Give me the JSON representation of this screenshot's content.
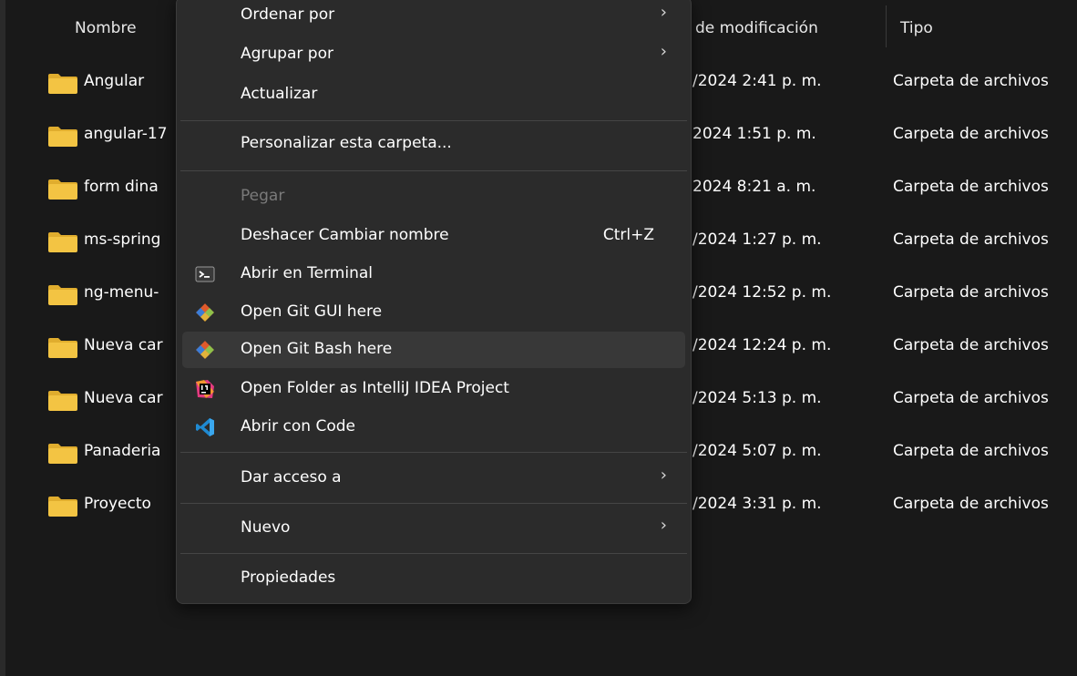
{
  "columns": {
    "name": "Nombre",
    "date": "de modificación",
    "type": "Tipo"
  },
  "rows": [
    {
      "name": "Angular",
      "date": "/2024 2:41 p. m.",
      "type": "Carpeta de archivos"
    },
    {
      "name": "angular-17",
      "date": "2024 1:51 p. m.",
      "type": "Carpeta de archivos"
    },
    {
      "name": "form dina",
      "date": "2024 8:21 a. m.",
      "type": "Carpeta de archivos"
    },
    {
      "name": "ms-spring",
      "date": "/2024 1:27 p. m.",
      "type": "Carpeta de archivos"
    },
    {
      "name": "ng-menu-",
      "date": "/2024 12:52 p. m.",
      "type": "Carpeta de archivos"
    },
    {
      "name": "Nueva car",
      "date": "/2024 12:24 p. m.",
      "type": "Carpeta de archivos"
    },
    {
      "name": "Nueva car",
      "date": "/2024 5:13 p. m.",
      "type": "Carpeta de archivos"
    },
    {
      "name": "Panaderia",
      "date": "/2024 5:07 p. m.",
      "type": "Carpeta de archivos"
    },
    {
      "name": "Proyecto",
      "date": "/2024 3:31 p. m.",
      "type": "Carpeta de archivos"
    }
  ],
  "menu": {
    "sort_by": "Ordenar por",
    "group_by": "Agrupar por",
    "refresh": "Actualizar",
    "customize": "Personalizar esta carpeta...",
    "paste": "Pegar",
    "undo": "Deshacer Cambiar nombre",
    "undo_shortcut": "Ctrl+Z",
    "open_terminal": "Abrir en Terminal",
    "git_gui": "Open Git GUI here",
    "git_bash": "Open Git Bash here",
    "intellij": "Open Folder as IntelliJ IDEA Project",
    "vscode": "Abrir con Code",
    "give_access": "Dar acceso a",
    "new": "Nuevo",
    "properties": "Propiedades",
    "submenu_arrow": "›"
  },
  "colors": {
    "background": "#191919",
    "menu_bg": "#2b2b2b",
    "folder": "#f3c443",
    "hover": "#383838"
  },
  "icons": {
    "folder": "folder-icon",
    "terminal": "terminal-icon",
    "git": "git-icon",
    "intellij": "intellij-icon",
    "vscode": "vscode-icon",
    "submenu": "chevron-right-icon"
  }
}
